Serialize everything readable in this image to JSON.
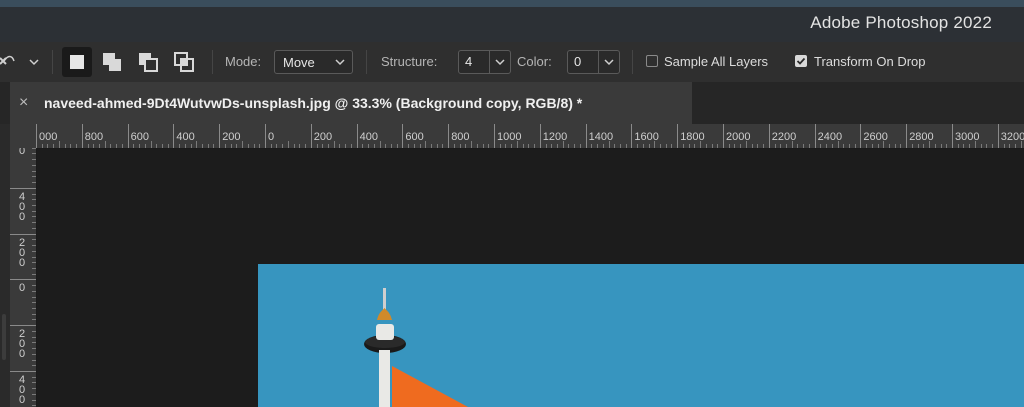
{
  "app": {
    "title": "Adobe Photoshop 2022"
  },
  "options": {
    "mode_label": "Mode:",
    "mode_value": "Move",
    "structure_label": "Structure:",
    "structure_value": "4",
    "color_label": "Color:",
    "color_value": "0",
    "sample_all_layers": {
      "label": "Sample All Layers",
      "checked": false
    },
    "transform_on_drop": {
      "label": "Transform On Drop",
      "checked": true
    }
  },
  "document": {
    "tab_title": "naveed-ahmed-9Dt4WutvwDs-unsplash.jpg @ 33.3% (Background copy, RGB/8) *",
    "close_glyph": "×"
  },
  "rulers": {
    "horizontal": [
      "000",
      "800",
      "600",
      "400",
      "200",
      "0",
      "200",
      "400",
      "600",
      "800",
      "1000",
      "1200",
      "1400",
      "1600",
      "1800",
      "2000",
      "2200",
      "2400",
      "2600",
      "2800",
      "3000",
      "3200"
    ],
    "vertical": [
      {
        "digits": [
          "0"
        ]
      },
      {
        "digits": [
          "4",
          "0",
          "0"
        ]
      },
      {
        "digits": [
          "2",
          "0",
          "0"
        ]
      },
      {
        "digits": [
          "0"
        ]
      },
      {
        "digits": [
          "2",
          "0",
          "0"
        ]
      },
      {
        "digits": [
          "4",
          "0",
          "0"
        ]
      }
    ]
  },
  "colors": {
    "sky": "#3795bf",
    "flag": "#ef6b1f",
    "pole": "#e9e9e6",
    "canvas_bg": "#1c1c1c"
  },
  "icons": {
    "tool_preset": "content-aware-move-icon",
    "mode_new": "new-selection-icon",
    "mode_add": "add-to-selection-icon",
    "mode_subtract": "subtract-from-selection-icon",
    "mode_intersect": "intersect-selection-icon"
  }
}
